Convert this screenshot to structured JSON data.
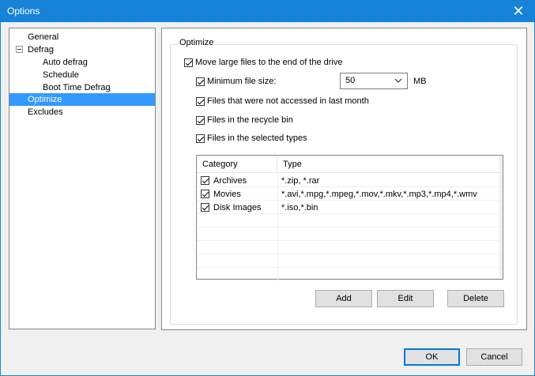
{
  "window": {
    "title": "Options",
    "close_glyph": "✕"
  },
  "tree": {
    "items": [
      {
        "label": "General"
      },
      {
        "label": "Defrag"
      },
      {
        "label": "Auto defrag"
      },
      {
        "label": "Schedule"
      },
      {
        "label": "Boot Time Defrag"
      },
      {
        "label": "Optimize",
        "selected": true
      },
      {
        "label": "Excludes"
      }
    ]
  },
  "optimize": {
    "group_label": "Optimize",
    "move_large_files": {
      "label": "Move large files to the end of the drive",
      "checked": true
    },
    "min_file_size": {
      "label": "Minimum file size:",
      "checked": true,
      "value": "50",
      "unit": "MB"
    },
    "not_accessed": {
      "label": "Files that were not accessed in last month",
      "checked": true
    },
    "recycle_bin": {
      "label": "Files in the recycle bin",
      "checked": true
    },
    "selected_types": {
      "label": "Files in the selected types",
      "checked": true
    },
    "table": {
      "columns": [
        "Category",
        "Type"
      ],
      "rows": [
        {
          "category": "Archives",
          "type": "*.zip, *.rar",
          "checked": true
        },
        {
          "category": "Movies",
          "type": "*.avi,*.mpg,*.mpeg,*.mov,*.mkv,*.mp3,*.mp4,*.wmv",
          "checked": true
        },
        {
          "category": "Disk Images",
          "type": "*.iso,*.bin",
          "checked": true
        }
      ]
    },
    "buttons": {
      "add": "Add",
      "edit": "Edit",
      "delete": "Delete"
    }
  },
  "footer": {
    "ok": "OK",
    "cancel": "Cancel"
  },
  "colors": {
    "titlebar": "#1683d8",
    "selection": "#3399ff",
    "primary_border": "#0078d7"
  }
}
